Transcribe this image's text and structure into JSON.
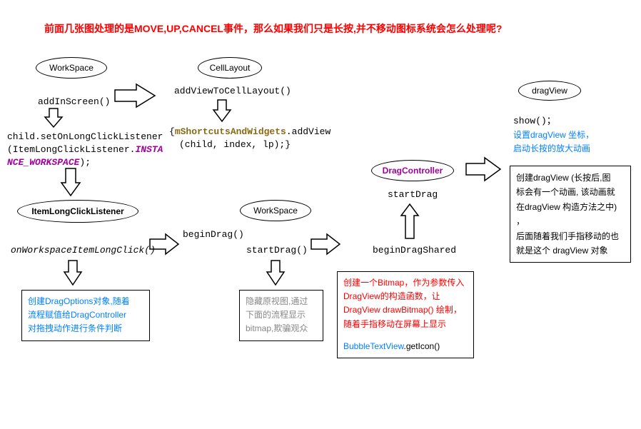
{
  "title": "前面几张图处理的是MOVE,UP,CANCEL事件，那么如果我们只是长按,并不移动图标系统会怎么处理呢?",
  "nodes": {
    "workspace1": "WorkSpace",
    "celllayout": "CellLayout",
    "dragview": "dragView",
    "itemlongclick": "ItemLongClickListener",
    "workspace2": "WorkSpace",
    "dragcontroller": "DragController"
  },
  "methods": {
    "addInScreen": "addInScreen()",
    "addViewToCellLayout": "addViewToCellLayout()",
    "onWorkspaceItemLongClick": "onWorkspaceItemLongClick()",
    "beginDrag": "beginDrag()",
    "startDrag1": "startDrag()",
    "startDrag2": "startDrag",
    "beginDragShared": "beginDragShared",
    "show": "show()；"
  },
  "code": {
    "longclick_line1a": "child.setOnLongClickListener",
    "longclick_line1b": "(ItemLongClickListener.",
    "longclick_instance": "INSTA",
    "longclick_instance2": "NCE_WORKSPACE",
    "longclick_end": ");",
    "shortcuts_open": "{",
    "shortcuts_widget": "mShortcutsAndWidgets",
    "shortcuts_add": ".addView",
    "shortcuts_line2": "(child, index, lp);}"
  },
  "boxes": {
    "dragoptions_l1": "创建DragOptions对象,随着",
    "dragoptions_l2": "流程赋值给DragController",
    "dragoptions_l3": "对拖拽动作进行条件判断",
    "hideview_l1": "隐藏原视图,通过",
    "hideview_l2": "下面的流程显示",
    "hideview_l3": "bitmap,欺骗观众",
    "bitmap_l1": "创建一个Bitmap，作为参数传入",
    "bitmap_l2": "DragView的构造函数，让",
    "bitmap_l3": "DragView drawBitmap() 绘制，",
    "bitmap_l4": "随着手指移动在屏幕上显示",
    "bitmap_l5a": "BubbleTextView",
    "bitmap_l5b": ".getIcon()",
    "dragview_l1": "设置dragView 坐标，",
    "dragview_l2": "启动长按的放大动画",
    "dragview2_l1": "创建dragView (长按后,图",
    "dragview2_l2": "标会有一个动画, 该动画就",
    "dragview2_l3": "在dragView 构造方法之中)",
    "dragview2_l4": "，",
    "dragview2_l5": "后面随着我们手指移动的也",
    "dragview2_l6": "就是这个 dragView 对象"
  }
}
